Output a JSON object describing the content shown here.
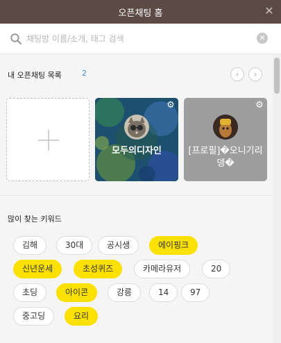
{
  "window": {
    "title": "오픈채팅 홈",
    "close_glyph": "✕"
  },
  "search": {
    "placeholder": "채팅방 이름/소개, 태그 검색",
    "clear_glyph": "✕"
  },
  "my_chats": {
    "label": "내 오픈채팅 목록",
    "count": "2",
    "prev_glyph": "‹",
    "next_glyph": "›",
    "cards": [
      {
        "name": "모두의디자인",
        "icon": "settings-icon",
        "gear_glyph": "⚙"
      },
      {
        "name": "[프로필]�오니기리뎅�",
        "icon": "settings-icon",
        "gear_glyph": "⚙"
      }
    ]
  },
  "keywords": {
    "title": "많이 찾는 키워드",
    "items": [
      {
        "label": "김해",
        "highlight": false
      },
      {
        "label": "30대",
        "highlight": false
      },
      {
        "label": "공시생",
        "highlight": false
      },
      {
        "label": "에이핑크",
        "highlight": true
      },
      {
        "label": "신년운세",
        "highlight": true
      },
      {
        "label": "초성퀴즈",
        "highlight": true
      },
      {
        "label": "카메라유저",
        "highlight": false
      },
      {
        "label": "20",
        "highlight": false
      },
      {
        "label": "초딩",
        "highlight": false
      },
      {
        "label": "아이콘",
        "highlight": true
      },
      {
        "label": "강릉",
        "highlight": false
      },
      {
        "label": "14",
        "highlight": false
      },
      {
        "label": "97",
        "highlight": false
      },
      {
        "label": "중고딩",
        "highlight": false
      },
      {
        "label": "요리",
        "highlight": true
      }
    ]
  },
  "colors": {
    "titlebar": "#5c4b45",
    "highlight": "#fae100",
    "count": "#3c8fd6"
  }
}
